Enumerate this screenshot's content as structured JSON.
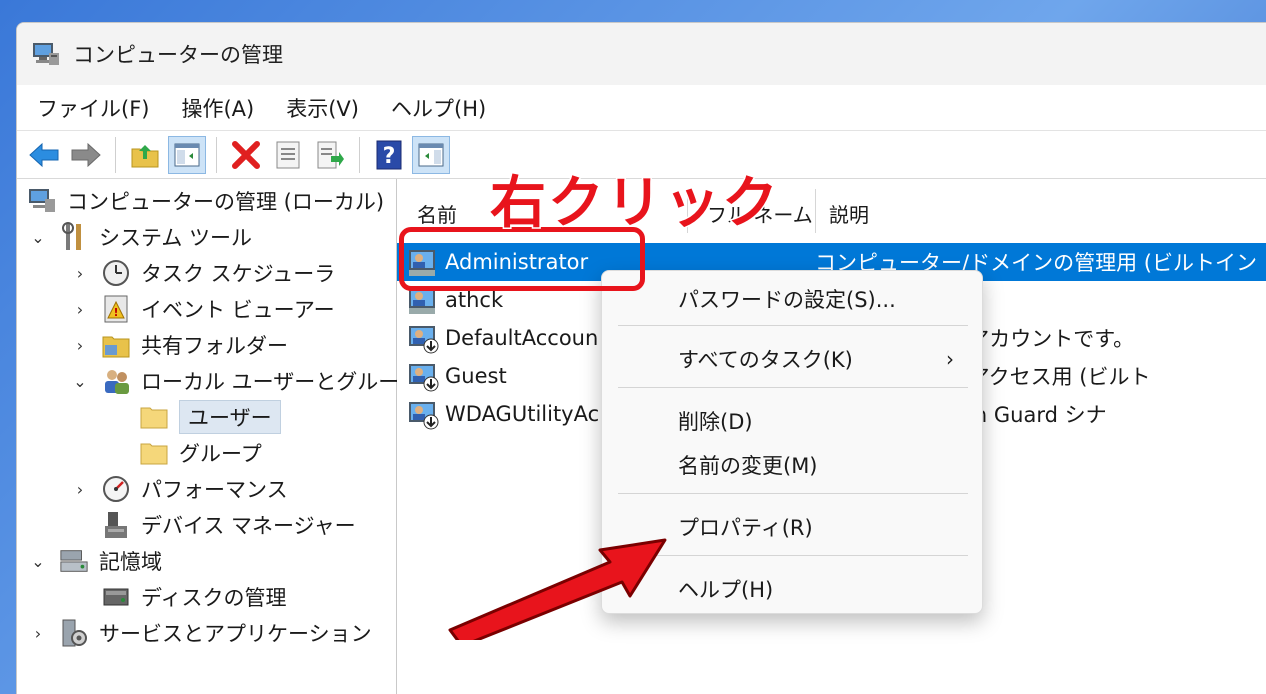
{
  "window": {
    "title": "コンピューターの管理"
  },
  "menu": [
    "ファイル(F)",
    "操作(A)",
    "表示(V)",
    "ヘルプ(H)"
  ],
  "toolbar": {
    "icons": [
      "back-arrow-icon",
      "forward-arrow-icon",
      "up-folder-icon",
      "show-tree-icon",
      "delete-icon",
      "properties-icon",
      "export-icon",
      "help-icon",
      "action-pane-icon"
    ]
  },
  "tree": {
    "root": "コンピューターの管理 (ローカル)",
    "system_tools": "システム ツール",
    "task_scheduler": "タスク スケジューラ",
    "event_viewer": "イベント ビューアー",
    "shared_folders": "共有フォルダー",
    "local_users_groups": "ローカル ユーザーとグループ",
    "users": "ユーザー",
    "groups": "グループ",
    "performance": "パフォーマンス",
    "device_manager": "デバイス マネージャー",
    "storage": "記憶域",
    "disk_management": "ディスクの管理",
    "services_apps": "サービスとアプリケーション"
  },
  "list": {
    "columns": [
      "名前",
      "フル ネーム",
      "説明"
    ],
    "rows": [
      {
        "name": "Administrator",
        "desc": "コンピューター/ドメインの管理用 (ビルトイン アカウ"
      },
      {
        "name": "athck",
        "desc": ""
      },
      {
        "name": "DefaultAccoun",
        "desc": "されるユーザー アカウントです。"
      },
      {
        "name": "Guest",
        "desc": "インへのゲスト アクセス用 (ビルト"
      },
      {
        "name": "WDAGUtilityAc",
        "desc": "nder Application Guard シナ"
      }
    ]
  },
  "context_menu": {
    "set_password": "パスワードの設定(S)...",
    "all_tasks": "すべてのタスク(K)",
    "all_tasks_arrow": "›",
    "delete": "削除(D)",
    "rename": "名前の変更(M)",
    "properties": "プロパティ(R)",
    "help": "ヘルプ(H)"
  },
  "annotation": {
    "text": "右クリック",
    "color": "#e8141c"
  },
  "colors": {
    "selection": "#0078d7",
    "tree_selection": "#dde7f2"
  }
}
